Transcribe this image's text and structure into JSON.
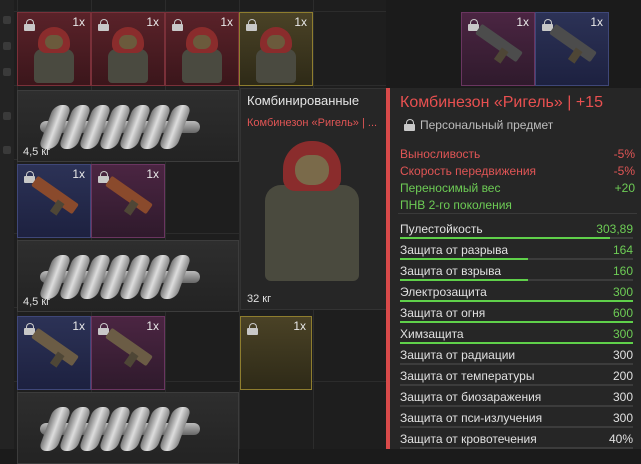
{
  "inventory": {
    "row1": [
      {
        "qty": "1x",
        "color": "red",
        "kind": "suit"
      },
      {
        "qty": "1x",
        "color": "red",
        "kind": "suit"
      },
      {
        "qty": "1x",
        "color": "red",
        "kind": "suit"
      },
      {
        "qty": "1x",
        "color": "yellow",
        "kind": "suit"
      },
      {
        "qty": "1x",
        "color": "purple",
        "kind": "smg"
      },
      {
        "qty": "1x",
        "color": "blue",
        "kind": "smg"
      }
    ],
    "cranks": [
      {
        "weight": "4,5 кг"
      },
      {
        "weight": "4,5 кг"
      },
      {
        "weight": ""
      }
    ],
    "row_guns_a": [
      {
        "qty": "1x",
        "color": "blue",
        "kind": "rifle"
      },
      {
        "qty": "1x",
        "color": "purple",
        "kind": "rifle"
      }
    ],
    "row_guns_b": [
      {
        "qty": "1x",
        "color": "blue",
        "kind": "gun"
      },
      {
        "qty": "1x",
        "color": "purple",
        "kind": "gun"
      }
    ],
    "yellow_lock_qty": "1x"
  },
  "preview": {
    "title": "Комбинированные",
    "subtitle": "Комбинезон «Ригель» | ...",
    "weight": "32 кг"
  },
  "tooltip": {
    "name": "Комбинезон «Ригель» | +15",
    "personal": "Персональный предмет",
    "modifiers": [
      {
        "label": "Выносливость",
        "value": "-5%",
        "color": "red"
      },
      {
        "label": "Скорость передвижения",
        "value": "-5%",
        "color": "red"
      },
      {
        "label": "Переносимый вес",
        "value": "+20",
        "color": "green"
      },
      {
        "label": "ПНВ 2-го поколения",
        "value": "",
        "color": "green"
      }
    ],
    "stats": [
      {
        "label": "Пулестойкость",
        "value": "303,89",
        "color": "green",
        "fill": 0.9
      },
      {
        "label": "Защита от разрыва",
        "value": "164",
        "color": "green",
        "fill": 0.55
      },
      {
        "label": "Защита от взрыва",
        "value": "160",
        "color": "green",
        "fill": 0.55
      },
      {
        "label": "Электрозащита",
        "value": "300",
        "color": "green",
        "fill": 1.0
      },
      {
        "label": "Защита от огня",
        "value": "600",
        "color": "green",
        "fill": 1.0
      },
      {
        "label": "Химзащита",
        "value": "300",
        "color": "green",
        "fill": 1.0
      },
      {
        "label": "Защита от радиации",
        "value": "300",
        "color": "white",
        "fill": 0
      },
      {
        "label": "Защита от температуры",
        "value": "200",
        "color": "white",
        "fill": 0
      },
      {
        "label": "Защита от биозаражения",
        "value": "300",
        "color": "white",
        "fill": 0
      },
      {
        "label": "Защита от пси-излучения",
        "value": "300",
        "color": "white",
        "fill": 0
      },
      {
        "label": "Защита от кровотечения",
        "value": "40%",
        "color": "white",
        "fill": 0
      }
    ]
  },
  "colors": {
    "bar_green": "#5fd04a",
    "accent_red": "#d94a4a"
  }
}
